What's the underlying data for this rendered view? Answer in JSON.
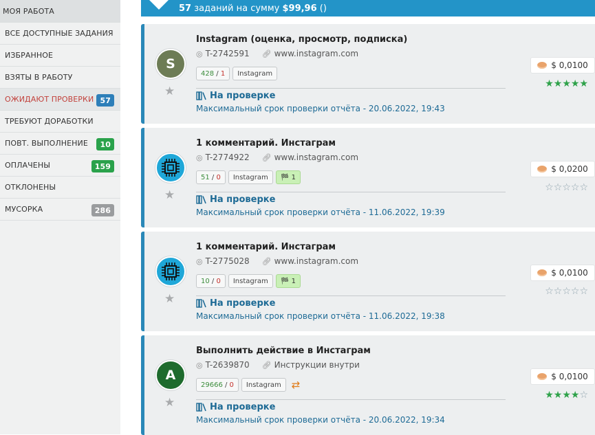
{
  "sidebar": {
    "header": "МОЯ РАБОТА",
    "items": [
      {
        "label": "ВСЕ ДОСТУПНЫЕ ЗАДАНИЯ",
        "badge": null
      },
      {
        "label": "ИЗБРАННОЕ",
        "badge": null
      },
      {
        "label": "ВЗЯТЫ В РАБОТУ",
        "badge": null
      },
      {
        "label": "ОЖИДАЮТ ПРОВЕРКИ",
        "badge": "57",
        "badge_color": "#2d7fb9",
        "active": true
      },
      {
        "label": "ТРЕБУЮТ ДОРАБОТКИ",
        "badge": null
      },
      {
        "label": "ПОВТ. ВЫПОЛНЕНИЕ",
        "badge": "10",
        "badge_color": "#2aa24b"
      },
      {
        "label": "ОПЛАЧЕНЫ",
        "badge": "159",
        "badge_color": "#2aa24b"
      },
      {
        "label": "ОТКЛОНЕНЫ",
        "badge": null
      },
      {
        "label": "МУСОРКА",
        "badge": "286",
        "badge_color": "#9a9c9e"
      }
    ]
  },
  "summary": {
    "count": "57",
    "text": "заданий на сумму",
    "amount": "$99,96",
    "suffix": "()"
  },
  "colors": {
    "accent": "#2394c8",
    "status": "#1d6a95",
    "active_nav": "#c2413b",
    "rating": "#2fa24a"
  },
  "tasks": [
    {
      "title": "Instagram (оценка, просмотр, подписка)",
      "id": "T-2742591",
      "link": "www.instagram.com",
      "avatar": {
        "type": "letter",
        "letter": "S",
        "color": "#6d7c55"
      },
      "done": "428",
      "rejected": "1",
      "platform": "Instagram",
      "flag": null,
      "recycle": false,
      "status": "На проверке",
      "deadline": "Максимальный срок проверки отчёта - 20.06.2022, 19:43",
      "price": "$ 0,0100",
      "rating": 5
    },
    {
      "title": "1 комментарий. Инстаграм",
      "id": "T-2774922",
      "link": "www.instagram.com",
      "avatar": {
        "type": "chip",
        "color": "#1fa7d8"
      },
      "done": "51",
      "rejected": "0",
      "platform": "Instagram",
      "flag": "1",
      "recycle": false,
      "status": "На проверке",
      "deadline": "Максимальный срок проверки отчёта - 11.06.2022, 19:39",
      "price": "$ 0,0200",
      "rating": 0
    },
    {
      "title": "1 комментарий. Инстаграм",
      "id": "T-2775028",
      "link": "www.instagram.com",
      "avatar": {
        "type": "chip",
        "color": "#1fa7d8"
      },
      "done": "10",
      "rejected": "0",
      "platform": "Instagram",
      "flag": "1",
      "recycle": false,
      "status": "На проверке",
      "deadline": "Максимальный срок проверки отчёта - 11.06.2022, 19:38",
      "price": "$ 0,0100",
      "rating": 0
    },
    {
      "title": "Выполнить действие в Инстаграм",
      "id": "T-2639870",
      "link": "Инструкции внутри",
      "avatar": {
        "type": "letter",
        "letter": "A",
        "color": "#1e6b2d"
      },
      "done": "29666",
      "rejected": "0",
      "platform": "Instagram",
      "flag": null,
      "recycle": true,
      "status": "На проверке",
      "deadline": "Максимальный срок проверки отчёта - 20.06.2022, 19:34",
      "price": "$ 0,0100",
      "rating": 4
    }
  ]
}
